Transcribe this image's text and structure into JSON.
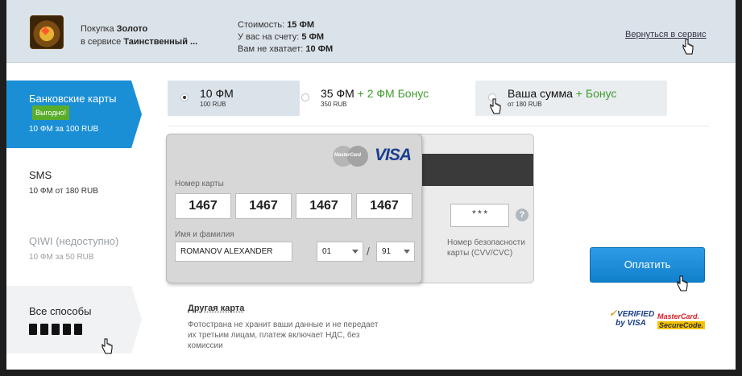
{
  "header": {
    "purchase_prefix": "Покупка ",
    "purchase_item": "Золото",
    "service_prefix": "в сервисе ",
    "service_name": "Таинственный ...",
    "cost_label": "Стоимость: ",
    "cost_value": "15 ФМ",
    "balance_label": "У вас на счету: ",
    "balance_value": "5 ФМ",
    "shortage_label": "Вам не хватает: ",
    "shortage_value": "10 ФМ",
    "back_link": "Вернуться в сервис"
  },
  "sidebar": {
    "items": [
      {
        "title": "Банковские карты",
        "badge": "Выгодно!",
        "sub": "10 ФМ за 100 RUB",
        "state": "active"
      },
      {
        "title": "SMS",
        "sub": "10 ФМ от 180 RUB",
        "state": "normal"
      },
      {
        "title": "QIWI (недоступно)",
        "sub": "10 ФМ за 50 RUB",
        "state": "disabled"
      },
      {
        "title": "Все способы",
        "state": "hover"
      }
    ]
  },
  "options": [
    {
      "main": "10 ФМ",
      "bonus": "",
      "sub": "100 RUB",
      "selected": true
    },
    {
      "main": "35 ФМ",
      "bonus": " + 2 ФМ Бонус",
      "sub": "350 RUB",
      "selected": false
    },
    {
      "main": "Ваша сумма",
      "bonus": " + Бонус",
      "sub": "от 180 RUB",
      "selected": false
    }
  ],
  "card": {
    "number_label": "Номер карты",
    "number_parts": [
      "1467",
      "1467",
      "1467",
      "1467"
    ],
    "name_label": "Имя и фамилия",
    "name_value": "ROMANOV ALEXANDER",
    "month_value": "01",
    "year_value": "91",
    "mc_text": "MasterCard",
    "visa_text": "VISA",
    "cvv_value": "***",
    "cvv_help": "?",
    "cvv_label": "Номер безопасности карты (CVV/CVC)"
  },
  "pay_button": "Оплатить",
  "other_card_link": "Другая карта",
  "info_text": "Фотострана не хранит ваши данные и не передает их третьим лицам, платеж включает НДС, без комиссии",
  "badges": {
    "vbv_line1": "VERIFIED",
    "vbv_line2": "by VISA",
    "mcsc_line1": "MasterCard.",
    "mcsc_line2": "SecureCode."
  },
  "colors": {
    "accent": "#1a8fd6",
    "bonus": "#3f9c2e",
    "badge": "#5aad2b"
  }
}
